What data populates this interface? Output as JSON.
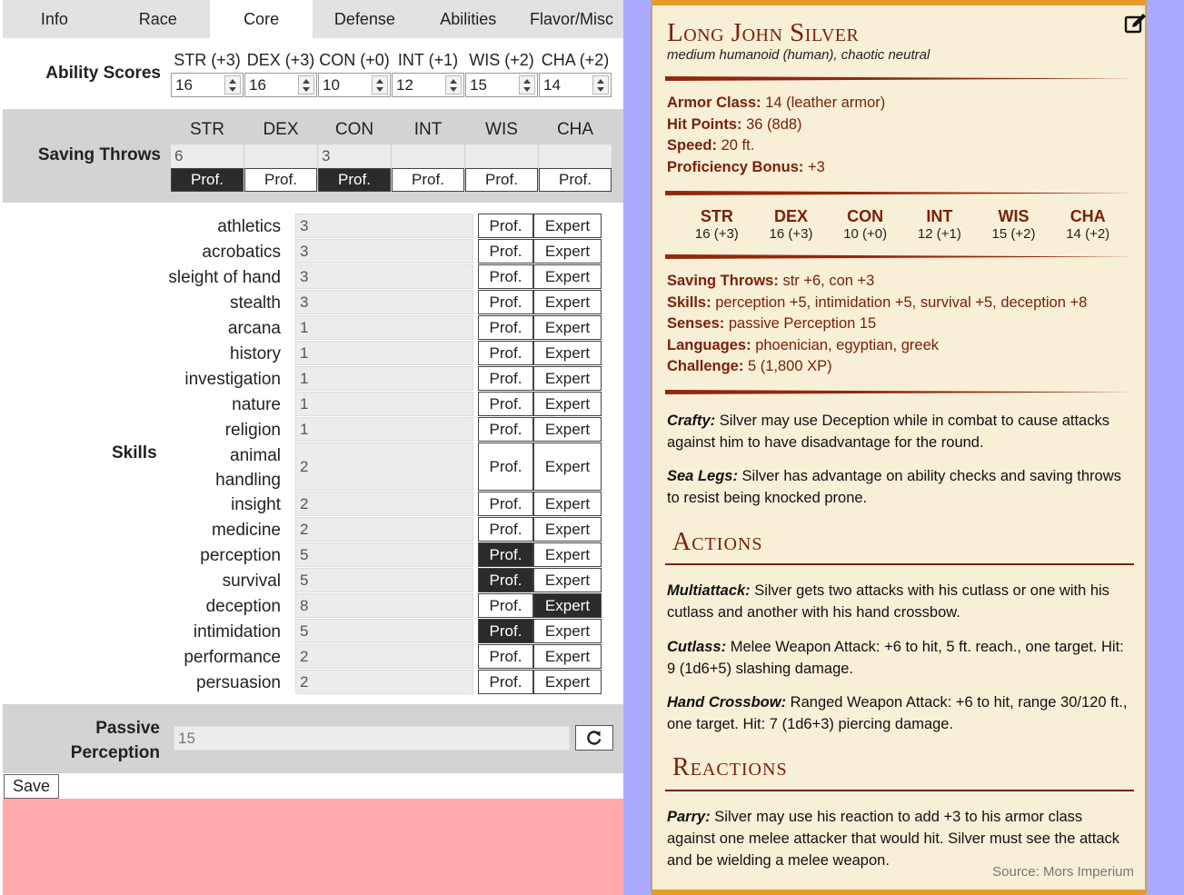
{
  "tabs": [
    "Info",
    "Race",
    "Core",
    "Defense",
    "Abilities",
    "Flavor/Misc"
  ],
  "active_tab": "Core",
  "ability_scores": {
    "label": "Ability Scores",
    "items": [
      {
        "caption": "STR (+3)",
        "value": "16"
      },
      {
        "caption": "DEX (+3)",
        "value": "16"
      },
      {
        "caption": "CON (+0)",
        "value": "10"
      },
      {
        "caption": "INT (+1)",
        "value": "12"
      },
      {
        "caption": "WIS (+2)",
        "value": "15"
      },
      {
        "caption": "CHA (+2)",
        "value": "14"
      }
    ]
  },
  "saving_throws": {
    "label": "Saving Throws",
    "prof_label": "Prof.",
    "items": [
      {
        "caption": "STR",
        "value": "6",
        "prof": true
      },
      {
        "caption": "DEX",
        "value": "",
        "prof": false
      },
      {
        "caption": "CON",
        "value": "3",
        "prof": true
      },
      {
        "caption": "INT",
        "value": "",
        "prof": false
      },
      {
        "caption": "WIS",
        "value": "",
        "prof": false
      },
      {
        "caption": "CHA",
        "value": "",
        "prof": false
      }
    ]
  },
  "skills": {
    "label": "Skills",
    "prof_label": "Prof.",
    "expert_label": "Expert",
    "items": [
      {
        "name": "athletics",
        "value": "3",
        "prof": false,
        "expert": false
      },
      {
        "name": "acrobatics",
        "value": "3",
        "prof": false,
        "expert": false
      },
      {
        "name": "sleight of hand",
        "value": "3",
        "prof": false,
        "expert": false
      },
      {
        "name": "stealth",
        "value": "3",
        "prof": false,
        "expert": false
      },
      {
        "name": "arcana",
        "value": "1",
        "prof": false,
        "expert": false
      },
      {
        "name": "history",
        "value": "1",
        "prof": false,
        "expert": false
      },
      {
        "name": "investigation",
        "value": "1",
        "prof": false,
        "expert": false
      },
      {
        "name": "nature",
        "value": "1",
        "prof": false,
        "expert": false
      },
      {
        "name": "religion",
        "value": "1",
        "prof": false,
        "expert": false
      },
      {
        "name": "animal handling",
        "value": "2",
        "prof": false,
        "expert": false
      },
      {
        "name": "insight",
        "value": "2",
        "prof": false,
        "expert": false
      },
      {
        "name": "medicine",
        "value": "2",
        "prof": false,
        "expert": false
      },
      {
        "name": "perception",
        "value": "5",
        "prof": true,
        "expert": false
      },
      {
        "name": "survival",
        "value": "5",
        "prof": true,
        "expert": false
      },
      {
        "name": "deception",
        "value": "8",
        "prof": false,
        "expert": true
      },
      {
        "name": "intimidation",
        "value": "5",
        "prof": true,
        "expert": false
      },
      {
        "name": "performance",
        "value": "2",
        "prof": false,
        "expert": false
      },
      {
        "name": "persuasion",
        "value": "2",
        "prof": false,
        "expert": false
      }
    ]
  },
  "passive": {
    "label": "Passive Perception",
    "value": "15",
    "refresh_icon": "refresh-icon"
  },
  "save_label": "Save",
  "statblock": {
    "name": "Long John Silver",
    "type": "medium humanoid (human), chaotic neutral",
    "lines1": [
      {
        "k": "Armor Class:",
        "v": " 14 (leather armor)"
      },
      {
        "k": "Hit Points:",
        "v": " 36 (8d8)"
      },
      {
        "k": "Speed:",
        "v": " 20 ft."
      },
      {
        "k": "Proficiency Bonus:",
        "v": " +3"
      }
    ],
    "abilities": [
      {
        "h": "STR",
        "s": "16 (+3)"
      },
      {
        "h": "DEX",
        "s": "16 (+3)"
      },
      {
        "h": "CON",
        "s": "10 (+0)"
      },
      {
        "h": "INT",
        "s": "12 (+1)"
      },
      {
        "h": "WIS",
        "s": "15 (+2)"
      },
      {
        "h": "CHA",
        "s": "14 (+2)"
      }
    ],
    "lines2": [
      {
        "k": "Saving Throws:",
        "v": " str +6, con +3"
      },
      {
        "k": "Skills:",
        "v": " perception +5, intimidation +5, survival +5, deception +8"
      },
      {
        "k": "Senses:",
        "v": "  passive Perception 15"
      },
      {
        "k": "Languages:",
        "v": " phoenician, egyptian, greek"
      },
      {
        "k": "Challenge:",
        "v": " 5 (1,800 XP)"
      }
    ],
    "traits": [
      {
        "k": "Crafty:",
        "v": " Silver may use Deception while in combat to cause attacks against him to have disadvantage for the round."
      },
      {
        "k": "Sea Legs:",
        "v": " Silver has advantage on ability checks and saving throws to resist being knocked prone."
      }
    ],
    "actions_title": "Actions",
    "actions": [
      {
        "k": "Multiattack:",
        "v": " Silver gets two attacks with his cutlass or one with his cutlass and another with his hand crossbow."
      },
      {
        "k": "Cutlass:",
        "v": " Melee Weapon Attack: +6 to hit, 5 ft. reach., one target. Hit: 9 (1d6+5) slashing damage."
      },
      {
        "k": "Hand Crossbow:",
        "v": " Ranged Weapon Attack: +6 to hit, range 30/120 ft., one target. Hit: 7 (1d6+3) piercing damage."
      }
    ],
    "reactions_title": "Reactions",
    "reactions": [
      {
        "k": "Parry:",
        "v": " Silver may use his reaction to add +3 to his armor class against one melee attacker that would hit. Silver must see the attack and be wielding a melee weapon."
      }
    ],
    "source": "Source: Mors Imperium"
  },
  "colors": {
    "accent": "#7a200d",
    "parchment": "#f7efd6",
    "gold_bar": "#e69a28",
    "side_bg": "#aaaaff",
    "error_box": "#ffaaaa"
  }
}
